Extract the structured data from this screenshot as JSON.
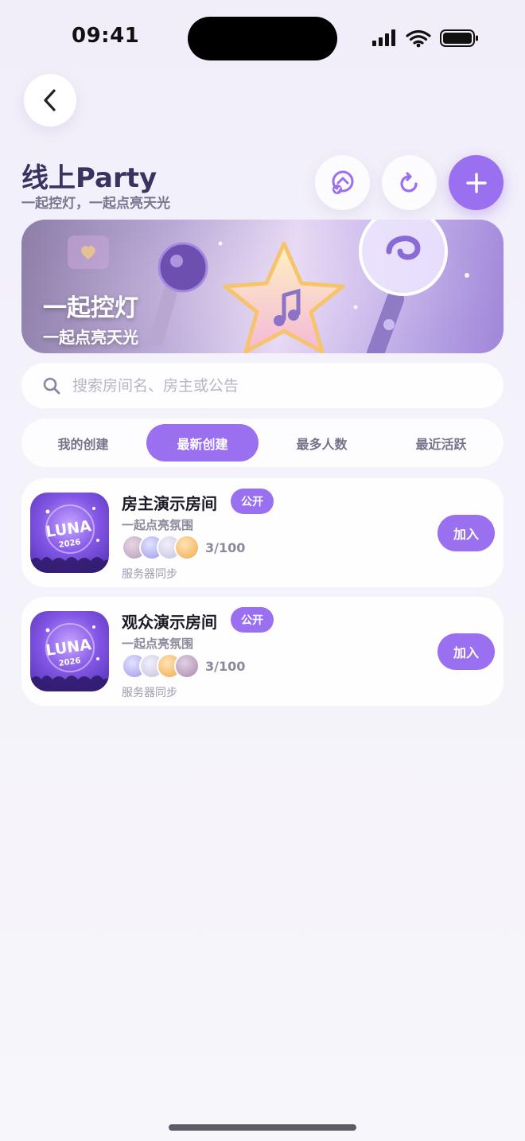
{
  "status_bar": {
    "time": "09:41"
  },
  "header": {
    "title": "线上Party",
    "subtitle": "一起控灯，一起点亮天光"
  },
  "banner": {
    "title": "一起控灯",
    "subtitle": "一起点亮天光"
  },
  "search": {
    "placeholder": "搜索房间名、房主或公告",
    "value": ""
  },
  "tabs": [
    {
      "label": "我的创建",
      "active": false
    },
    {
      "label": "最新创建",
      "active": true
    },
    {
      "label": "最多人数",
      "active": false
    },
    {
      "label": "最近活跃",
      "active": false
    }
  ],
  "rooms": [
    {
      "name": "房主演示房间",
      "badge": "公开",
      "description": "一起点亮氛围",
      "count": "3/100",
      "sync": "服务器同步",
      "join_label": "加入",
      "thumb_text": "LUNA",
      "thumb_year": "2026"
    },
    {
      "name": "观众演示房间",
      "badge": "公开",
      "description": "一起点亮氛围",
      "count": "3/100",
      "sync": "服务器同步",
      "join_label": "加入",
      "thumb_text": "LUNA",
      "thumb_year": "2026"
    }
  ],
  "colors": {
    "accent": "#9a6ff0",
    "title": "#3a3360"
  },
  "icons": {
    "back": "chevron-left-icon",
    "party": "party-icon",
    "refresh": "refresh-icon",
    "add": "plus-icon",
    "search": "search-icon"
  }
}
